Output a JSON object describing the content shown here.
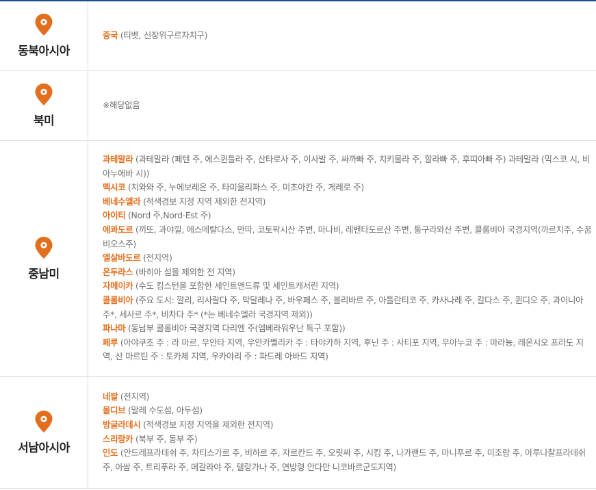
{
  "colors": {
    "accent": "#e36f1e",
    "top_rule": "#1f4e8c",
    "border": "#dcdcdc",
    "region_text": "#222222",
    "detail_text": "#6f6f6f"
  },
  "regions": [
    {
      "name": "동북아시아",
      "icon": "map-pin-icon",
      "entries": [
        {
          "country": "중국",
          "detail": "(티벳, 신장위구르자치구)"
        }
      ]
    },
    {
      "name": "북미",
      "icon": "map-pin-icon",
      "none_text": "※해당없음"
    },
    {
      "name": "중남미",
      "icon": "map-pin-icon",
      "entries": [
        {
          "country": "과테말라",
          "detail": "(과테말라 (페텐 주, 에스퀸틀라 주, 산타로사 주, 이사발 주, 싸까빠 주, 치키물라 주, 할라빠 주, 후띠아빠 주) 과테말라 (믹스코 시, 비아누에바 시))"
        },
        {
          "country": "멕시코",
          "detail": "(치와와 주, 누에보레온 주, 타미울리파스 주, 미초아칸 주, 게레로 주)"
        },
        {
          "country": "베네수엘라",
          "detail": "(적색경보 지정 지역 제외한 전지역)"
        },
        {
          "country": "아이티",
          "detail": "(Nord 주,Nord-Est 주)"
        },
        {
          "country": "에콰도르",
          "detail": "(끼또, 과야낄, 에스메랄다스, 만따, 코토팍시산 주변, 마나비, 레벤타도르산 주변, 퉁구라와산 주변, 콜롬비아 국경지역(까르치주, 수꿈비오스주)"
        },
        {
          "country": "엘살바도르",
          "detail": "(전지역)"
        },
        {
          "country": "온두라스",
          "detail": "(바히아 섬을 제외한 전 지역)"
        },
        {
          "country": "자메이카",
          "detail": "(수도 킹스턴을 포함한 세인트앤드류 및 세인트캐서린 지역)"
        },
        {
          "country": "콜롬비아",
          "detail": "(주요 도시: 깔리, 리사랄다 주, 막달레나 주, 바우페스 주, 볼리바르 주, 아틀란티코 주, 카사나레 주, 칼다스 주, 퀸디오 주, 과이니아 주*, 세사르 주*, 비차다 주* (*는 베네수엘라 국경지역 제외))"
        },
        {
          "country": "파나마",
          "detail": "(동남부 콜롬비아 국경지역 다리엔 주(엠베라워우난 특구 포함))"
        },
        {
          "country": "페루",
          "detail": "(아야쿠초 주 : 라 마르, 우안타 지역, 우안카벨리카 주 : 타야카하 지역, 후닌 주 : 사티포 지역, 우아누코 주 : 마라뇽, 레온시오 프라도 지역, 산 마르틴 주 : 토카체 지역, 우카야리 주 : 파드레 아바드 지역)"
        }
      ]
    },
    {
      "name": "서남아시아",
      "icon": "map-pin-icon",
      "entries": [
        {
          "country": "네팔",
          "detail": "(전지역)"
        },
        {
          "country": "몰디브",
          "detail": "(말레 수도섬, 아두섬)"
        },
        {
          "country": "방글라데시",
          "detail": "(적색경보 지정 지역을 제외한 전지역)"
        },
        {
          "country": "스리랑카",
          "detail": "(북부 주, 동부 주)"
        },
        {
          "country": "인도",
          "detail": "(안드레프라데쉬 주, 차티스가르 주, 비하르 주, 자르칸드 주, 오릿싸 주, 시킴 주, 나가랜드 주, 마니푸르 주, 미조람 주, 아루나찰프라데쉬 주, 아쌈 주, 트리푸라 주, 메갈라야 주, 텔랑가나 주, 연방령 안다만 니코바르군도지역)"
        }
      ]
    }
  ]
}
